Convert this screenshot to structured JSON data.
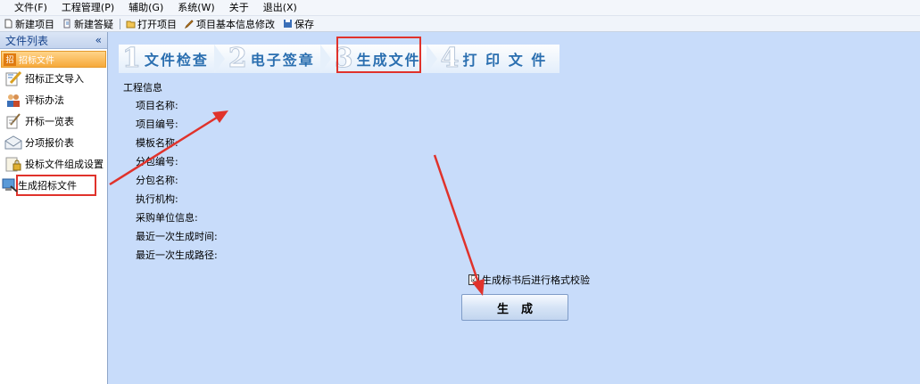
{
  "menubar": {
    "items": [
      "文件(F)",
      "工程管理(P)",
      "辅助(G)",
      "系统(W)",
      "关于",
      "退出(X)"
    ]
  },
  "toolbar": {
    "new_project": "新建项目",
    "new_qa": "新建答疑",
    "open_project": "打开项目",
    "edit_project_info": "项目基本信息修改",
    "save": "保存"
  },
  "sidebar": {
    "header": "文件列表",
    "collapse_glyph": "«",
    "group_icon_text": "招",
    "group": "招标文件",
    "items": [
      "招标正文导入",
      "评标办法",
      "开标一览表",
      "分项报价表",
      "投标文件组成设置",
      "生成招标文件"
    ]
  },
  "steps": [
    {
      "num": "1",
      "label": "文件检查"
    },
    {
      "num": "2",
      "label": "电子签章"
    },
    {
      "num": "3",
      "label": "生成文件"
    },
    {
      "num": "4",
      "label": "打 印 文 件"
    }
  ],
  "info": {
    "title": "工程信息",
    "fields": [
      "项目名称:",
      "项目编号:",
      "模板名称:",
      "分包编号:",
      "分包名称:",
      "执行机构:",
      "采购单位信息:",
      "最近一次生成时间:",
      "最近一次生成路径:"
    ]
  },
  "checkbox": {
    "mark": "☑",
    "label": "生成标书后进行格式校验"
  },
  "generate_button": "生成",
  "colors": {
    "highlight": "#e0322b",
    "main_bg": "#c8dcfa",
    "step_text": "#2b6fb0"
  }
}
